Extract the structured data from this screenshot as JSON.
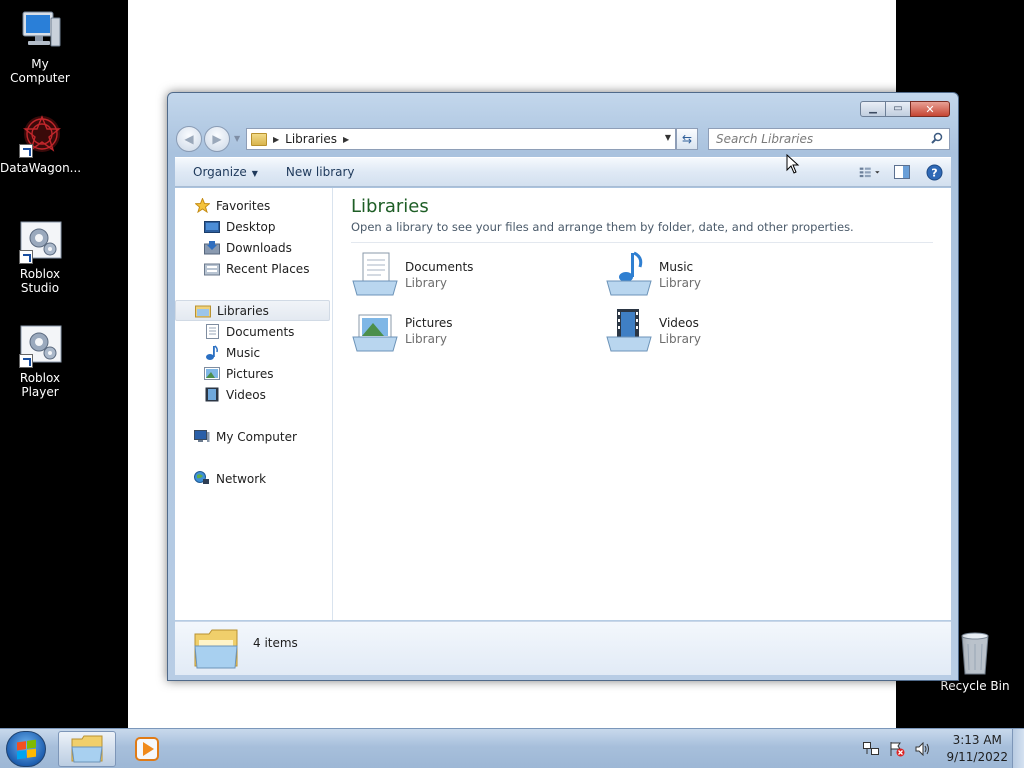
{
  "desktop": {
    "icons": [
      {
        "label": "My Computer",
        "icon": "computer-icon"
      },
      {
        "label": "DataWagon...",
        "icon": "datawagon-icon"
      },
      {
        "label": "Roblox Studio",
        "icon": "roblox-studio-icon"
      },
      {
        "label": "Roblox Player",
        "icon": "roblox-player-icon"
      },
      {
        "label": "Recycle Bin",
        "icon": "recycle-bin-icon"
      }
    ]
  },
  "window": {
    "title": "",
    "address": {
      "crumb": "Libraries"
    },
    "search": {
      "placeholder": "Search Libraries"
    },
    "toolbar": {
      "organize": "Organize",
      "new_library": "New library"
    },
    "nav": {
      "favorites": "Favorites",
      "desktop": "Desktop",
      "downloads": "Downloads",
      "recent_places": "Recent Places",
      "libraries": "Libraries",
      "documents": "Documents",
      "music": "Music",
      "pictures": "Pictures",
      "videos": "Videos",
      "my_computer": "My Computer",
      "network": "Network"
    },
    "main": {
      "title": "Libraries",
      "subtitle": "Open a library to see your files and arrange them by folder, date, and other properties.",
      "libraries": [
        {
          "name": "Documents",
          "type": "Library",
          "icon": "documents-library-icon"
        },
        {
          "name": "Music",
          "type": "Library",
          "icon": "music-library-icon"
        },
        {
          "name": "Pictures",
          "type": "Library",
          "icon": "pictures-library-icon"
        },
        {
          "name": "Videos",
          "type": "Library",
          "icon": "videos-library-icon"
        }
      ]
    },
    "details": {
      "count": "4 items"
    }
  },
  "taskbar": {
    "time": "3:13 AM",
    "date": "9/11/2022"
  },
  "colors": {
    "accent_title": "#1e5e26",
    "taskbar": "#a7bfdb",
    "desktop": "#000000"
  }
}
